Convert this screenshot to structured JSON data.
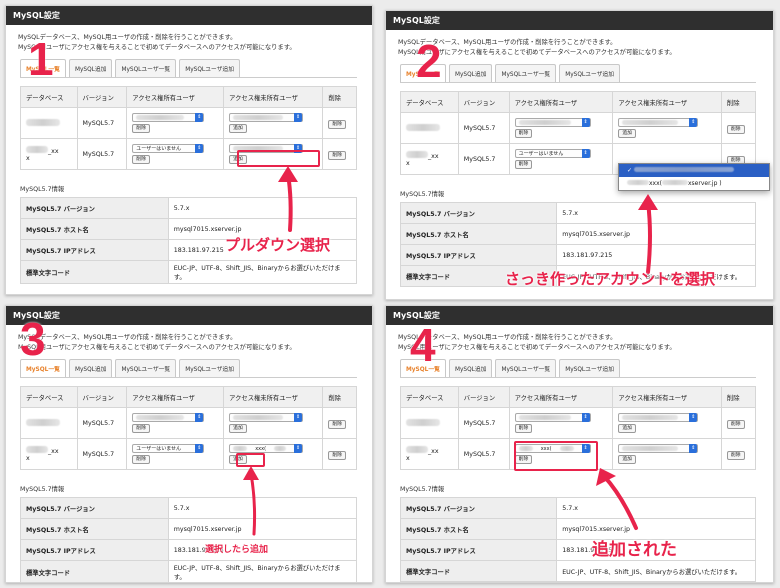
{
  "header_title": "MySQL設定",
  "intro_lines": [
    "MySQLデータベース、MySQL用ユーザの作成・削除を行うことができます。",
    "MySQL用ユーザにアクセス権を与えることで初めてデータベースへのアクセスが可能になります。"
  ],
  "tabs": [
    "MySQL一覧",
    "MySQL追加",
    "MySQLユーザ一覧",
    "MySQLユーザ追加"
  ],
  "table_headers": [
    "データベース",
    "バージョン",
    "アクセス権所有ユーザ",
    "アクセス権未所有ユーザ",
    "削除"
  ],
  "db_rows": [
    {
      "db_suffix": "",
      "version": "MySQL5.7"
    },
    {
      "db_suffix": "_xx",
      "db_line2": "x",
      "version": "MySQL5.7"
    }
  ],
  "no_user_option": "ユーザーはいません",
  "buttons": {
    "delete": "削除",
    "add": "追加"
  },
  "info_title": "MySQL5.7情報",
  "info_rows": [
    {
      "label": "MySQL5.7 バージョン",
      "value": "5.7.x"
    },
    {
      "label": "MySQL5.7 ホスト名",
      "value": "mysql7015.xserver.jp"
    },
    {
      "label": "MySQL5.7 IPアドレス",
      "value": "183.181.97.215"
    },
    {
      "label": "標準文字コード",
      "value": "EUC-JP、UTF-8、Shift_JIS、Binaryからお選びいただけます。"
    }
  ],
  "dropdown_options": [
    "",
    "xxx(",
    "xserver.jp )"
  ],
  "selected_value": "xxx(",
  "steps": {
    "n1": "1",
    "n2": "2",
    "n3": "3",
    "n4": "4",
    "c1": "プルダウン選択",
    "c2": "さっき作ったアカウントを選択",
    "c3": "選択したら追加",
    "c4": "追加された"
  },
  "accent_color": "#e8234b"
}
